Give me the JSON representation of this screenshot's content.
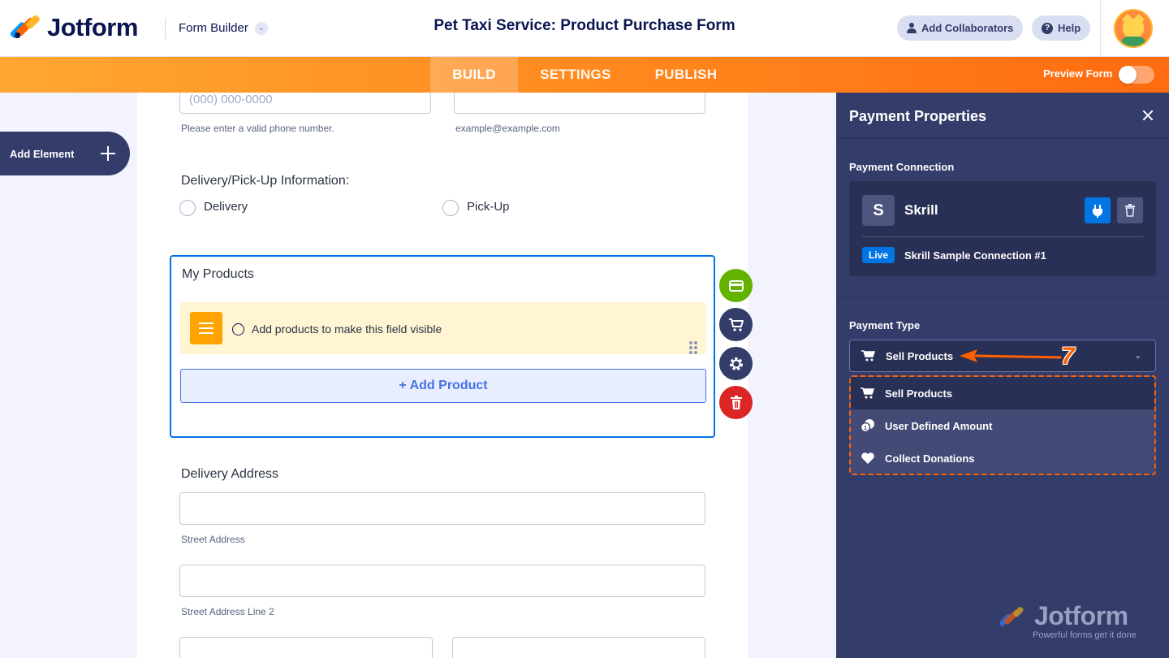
{
  "header": {
    "logo_text": "Jotform",
    "builder_label": "Form Builder",
    "form_title": "Pet Taxi Service: Product Purchase Form",
    "add_collaborators": "Add Collaborators",
    "help": "Help"
  },
  "nav": {
    "tabs": [
      "BUILD",
      "SETTINGS",
      "PUBLISH"
    ],
    "active_tab": "BUILD",
    "preview_label": "Preview Form",
    "preview_on": false
  },
  "sidebar": {
    "add_element": "Add Element"
  },
  "form": {
    "phone_placeholder": "(000) 000-0000",
    "phone_sublabel": "Please enter a valid phone number.",
    "email_sublabel": "example@example.com",
    "delivery_label": "Delivery/Pick-Up Information:",
    "delivery_options": [
      "Delivery",
      "Pick-Up"
    ],
    "products": {
      "title": "My Products",
      "notice": "Add products to make this field visible",
      "add_button": "+ Add Product"
    },
    "address_label": "Delivery Address",
    "street_sublabel": "Street Address",
    "street2_sublabel": "Street Address Line 2"
  },
  "panel": {
    "title": "Payment Properties",
    "connection_label": "Payment Connection",
    "gateway_initial": "S",
    "gateway_name": "Skrill",
    "live_badge": "Live",
    "connection_name": "Skrill Sample Connection #1",
    "payment_type_label": "Payment Type",
    "selected_type": "Sell Products",
    "options": [
      "Sell Products",
      "User Defined Amount",
      "Collect Donations"
    ]
  },
  "annotation": {
    "step_number": "7",
    "color": "#ff6100"
  },
  "watermark": {
    "brand": "Jotform",
    "tagline": "Powerful forms get it done"
  },
  "colors": {
    "brand_navy": "#0a1551",
    "orange": "#ff6100",
    "blue": "#0075e3",
    "panel_bg": "#343c6a"
  }
}
